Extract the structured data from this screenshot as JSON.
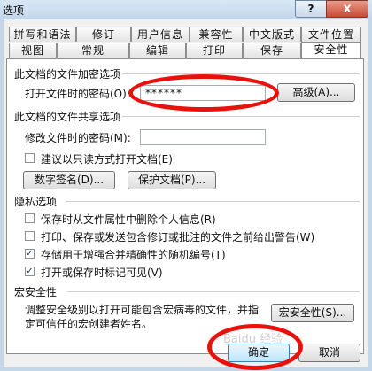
{
  "window": {
    "title": "选项",
    "help_label": "?",
    "close_label": "X"
  },
  "tabs_row1": [
    "拼写和语法",
    "修订",
    "用户信息",
    "兼容性",
    "中文版式",
    "文件位置"
  ],
  "tabs_row2": [
    "视图",
    "常规",
    "编辑",
    "打印",
    "保存",
    "安全性"
  ],
  "active_tab": "安全性",
  "encrypt": {
    "heading": "此文档的文件加密选项",
    "password_label": "打开文件时的密码(O):",
    "password_value": "******",
    "advanced_button": "高级(A)..."
  },
  "share": {
    "heading": "此文档的文件共享选项",
    "modify_label": "修改文件时的密码(M):",
    "modify_value": "",
    "readonly_label": "建议以只读方式打开文档(E)",
    "readonly_checked": false,
    "signature_button": "数字签名(D)...",
    "protect_button": "保护文档(P)..."
  },
  "privacy": {
    "heading": "隐私选项",
    "options": [
      {
        "label": "保存时从文件属性中删除个人信息(R)",
        "checked": false
      },
      {
        "label": "打印、保存或发送包含修订或批注的文件之前给出警告(W)",
        "checked": false
      },
      {
        "label": "存储用于增强合并精确性的随机编号(T)",
        "checked": true
      },
      {
        "label": "打开或保存时标记可见(V)",
        "checked": true
      }
    ]
  },
  "macro": {
    "heading": "宏安全性",
    "description_line1": "调整安全级别以打开可能包含宏病毒的文件，并指",
    "description_line2": "定可信任的宏创建者姓名。",
    "button": "宏安全性(S)..."
  },
  "footer": {
    "ok": "确定",
    "cancel": "取消"
  },
  "watermark": "Baidu 经验",
  "annotation_color": "#e8110b"
}
